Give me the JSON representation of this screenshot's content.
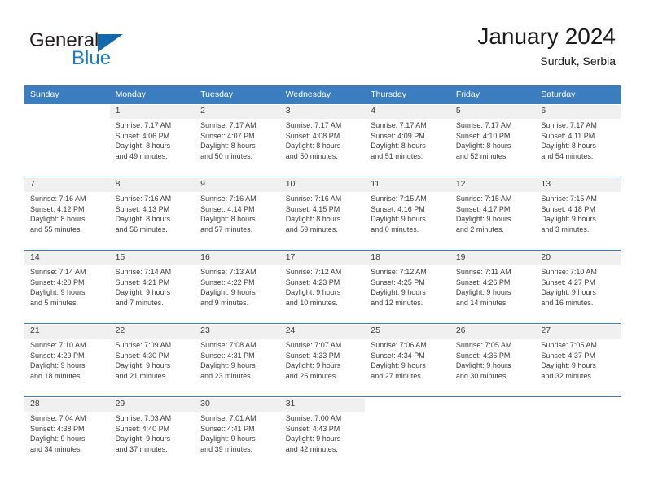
{
  "brand": {
    "name_part1": "General",
    "name_part2": "Blue",
    "flag_icon": "triangle-flag-icon",
    "accent_color": "#1668ad"
  },
  "header": {
    "title": "January 2024",
    "subtitle": "Surduk, Serbia"
  },
  "calendar": {
    "header_bg": "#3b7dbf",
    "weekday_headers": [
      "Sunday",
      "Monday",
      "Tuesday",
      "Wednesday",
      "Thursday",
      "Friday",
      "Saturday"
    ],
    "weeks": [
      [
        {
          "day": "",
          "sunrise": "",
          "sunset": "",
          "daylight1": "",
          "daylight2": ""
        },
        {
          "day": "1",
          "sunrise": "Sunrise: 7:17 AM",
          "sunset": "Sunset: 4:06 PM",
          "daylight1": "Daylight: 8 hours",
          "daylight2": "and 49 minutes."
        },
        {
          "day": "2",
          "sunrise": "Sunrise: 7:17 AM",
          "sunset": "Sunset: 4:07 PM",
          "daylight1": "Daylight: 8 hours",
          "daylight2": "and 50 minutes."
        },
        {
          "day": "3",
          "sunrise": "Sunrise: 7:17 AM",
          "sunset": "Sunset: 4:08 PM",
          "daylight1": "Daylight: 8 hours",
          "daylight2": "and 50 minutes."
        },
        {
          "day": "4",
          "sunrise": "Sunrise: 7:17 AM",
          "sunset": "Sunset: 4:09 PM",
          "daylight1": "Daylight: 8 hours",
          "daylight2": "and 51 minutes."
        },
        {
          "day": "5",
          "sunrise": "Sunrise: 7:17 AM",
          "sunset": "Sunset: 4:10 PM",
          "daylight1": "Daylight: 8 hours",
          "daylight2": "and 52 minutes."
        },
        {
          "day": "6",
          "sunrise": "Sunrise: 7:17 AM",
          "sunset": "Sunset: 4:11 PM",
          "daylight1": "Daylight: 8 hours",
          "daylight2": "and 54 minutes."
        }
      ],
      [
        {
          "day": "7",
          "sunrise": "Sunrise: 7:16 AM",
          "sunset": "Sunset: 4:12 PM",
          "daylight1": "Daylight: 8 hours",
          "daylight2": "and 55 minutes."
        },
        {
          "day": "8",
          "sunrise": "Sunrise: 7:16 AM",
          "sunset": "Sunset: 4:13 PM",
          "daylight1": "Daylight: 8 hours",
          "daylight2": "and 56 minutes."
        },
        {
          "day": "9",
          "sunrise": "Sunrise: 7:16 AM",
          "sunset": "Sunset: 4:14 PM",
          "daylight1": "Daylight: 8 hours",
          "daylight2": "and 57 minutes."
        },
        {
          "day": "10",
          "sunrise": "Sunrise: 7:16 AM",
          "sunset": "Sunset: 4:15 PM",
          "daylight1": "Daylight: 8 hours",
          "daylight2": "and 59 minutes."
        },
        {
          "day": "11",
          "sunrise": "Sunrise: 7:15 AM",
          "sunset": "Sunset: 4:16 PM",
          "daylight1": "Daylight: 9 hours",
          "daylight2": "and 0 minutes."
        },
        {
          "day": "12",
          "sunrise": "Sunrise: 7:15 AM",
          "sunset": "Sunset: 4:17 PM",
          "daylight1": "Daylight: 9 hours",
          "daylight2": "and 2 minutes."
        },
        {
          "day": "13",
          "sunrise": "Sunrise: 7:15 AM",
          "sunset": "Sunset: 4:18 PM",
          "daylight1": "Daylight: 9 hours",
          "daylight2": "and 3 minutes."
        }
      ],
      [
        {
          "day": "14",
          "sunrise": "Sunrise: 7:14 AM",
          "sunset": "Sunset: 4:20 PM",
          "daylight1": "Daylight: 9 hours",
          "daylight2": "and 5 minutes."
        },
        {
          "day": "15",
          "sunrise": "Sunrise: 7:14 AM",
          "sunset": "Sunset: 4:21 PM",
          "daylight1": "Daylight: 9 hours",
          "daylight2": "and 7 minutes."
        },
        {
          "day": "16",
          "sunrise": "Sunrise: 7:13 AM",
          "sunset": "Sunset: 4:22 PM",
          "daylight1": "Daylight: 9 hours",
          "daylight2": "and 9 minutes."
        },
        {
          "day": "17",
          "sunrise": "Sunrise: 7:12 AM",
          "sunset": "Sunset: 4:23 PM",
          "daylight1": "Daylight: 9 hours",
          "daylight2": "and 10 minutes."
        },
        {
          "day": "18",
          "sunrise": "Sunrise: 7:12 AM",
          "sunset": "Sunset: 4:25 PM",
          "daylight1": "Daylight: 9 hours",
          "daylight2": "and 12 minutes."
        },
        {
          "day": "19",
          "sunrise": "Sunrise: 7:11 AM",
          "sunset": "Sunset: 4:26 PM",
          "daylight1": "Daylight: 9 hours",
          "daylight2": "and 14 minutes."
        },
        {
          "day": "20",
          "sunrise": "Sunrise: 7:10 AM",
          "sunset": "Sunset: 4:27 PM",
          "daylight1": "Daylight: 9 hours",
          "daylight2": "and 16 minutes."
        }
      ],
      [
        {
          "day": "21",
          "sunrise": "Sunrise: 7:10 AM",
          "sunset": "Sunset: 4:29 PM",
          "daylight1": "Daylight: 9 hours",
          "daylight2": "and 18 minutes."
        },
        {
          "day": "22",
          "sunrise": "Sunrise: 7:09 AM",
          "sunset": "Sunset: 4:30 PM",
          "daylight1": "Daylight: 9 hours",
          "daylight2": "and 21 minutes."
        },
        {
          "day": "23",
          "sunrise": "Sunrise: 7:08 AM",
          "sunset": "Sunset: 4:31 PM",
          "daylight1": "Daylight: 9 hours",
          "daylight2": "and 23 minutes."
        },
        {
          "day": "24",
          "sunrise": "Sunrise: 7:07 AM",
          "sunset": "Sunset: 4:33 PM",
          "daylight1": "Daylight: 9 hours",
          "daylight2": "and 25 minutes."
        },
        {
          "day": "25",
          "sunrise": "Sunrise: 7:06 AM",
          "sunset": "Sunset: 4:34 PM",
          "daylight1": "Daylight: 9 hours",
          "daylight2": "and 27 minutes."
        },
        {
          "day": "26",
          "sunrise": "Sunrise: 7:05 AM",
          "sunset": "Sunset: 4:36 PM",
          "daylight1": "Daylight: 9 hours",
          "daylight2": "and 30 minutes."
        },
        {
          "day": "27",
          "sunrise": "Sunrise: 7:05 AM",
          "sunset": "Sunset: 4:37 PM",
          "daylight1": "Daylight: 9 hours",
          "daylight2": "and 32 minutes."
        }
      ],
      [
        {
          "day": "28",
          "sunrise": "Sunrise: 7:04 AM",
          "sunset": "Sunset: 4:38 PM",
          "daylight1": "Daylight: 9 hours",
          "daylight2": "and 34 minutes."
        },
        {
          "day": "29",
          "sunrise": "Sunrise: 7:03 AM",
          "sunset": "Sunset: 4:40 PM",
          "daylight1": "Daylight: 9 hours",
          "daylight2": "and 37 minutes."
        },
        {
          "day": "30",
          "sunrise": "Sunrise: 7:01 AM",
          "sunset": "Sunset: 4:41 PM",
          "daylight1": "Daylight: 9 hours",
          "daylight2": "and 39 minutes."
        },
        {
          "day": "31",
          "sunrise": "Sunrise: 7:00 AM",
          "sunset": "Sunset: 4:43 PM",
          "daylight1": "Daylight: 9 hours",
          "daylight2": "and 42 minutes."
        },
        {
          "day": "",
          "sunrise": "",
          "sunset": "",
          "daylight1": "",
          "daylight2": ""
        },
        {
          "day": "",
          "sunrise": "",
          "sunset": "",
          "daylight1": "",
          "daylight2": ""
        },
        {
          "day": "",
          "sunrise": "",
          "sunset": "",
          "daylight1": "",
          "daylight2": ""
        }
      ]
    ]
  }
}
